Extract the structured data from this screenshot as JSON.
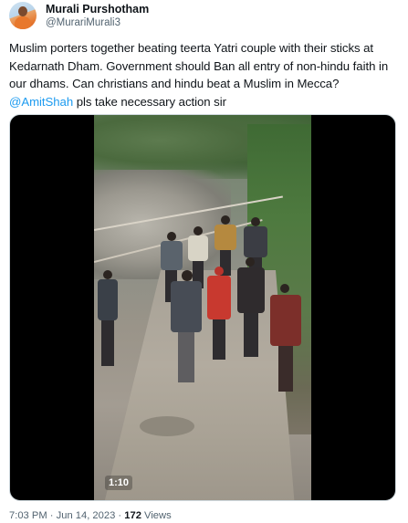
{
  "author": {
    "display_name": "Murali Purshotham",
    "handle": "@MurariMurali3",
    "avatar_icon": "profile-photo-avatar"
  },
  "tweet": {
    "lines": [
      "Muslim porters together beating teerta Yatri couple with their sticks at",
      "Kedarnath Dham. Government should Ban all entry of non-hindu faith in",
      "our dhams. Can christians and hindu beat a Muslim in Mecca?"
    ],
    "mention": "@AmitShah",
    "mention_rest": " pls take necessary action sir",
    "mention_color": "#1d9bf0"
  },
  "media": {
    "duration": "1:10"
  },
  "meta": {
    "time": "7:03 PM",
    "separator": " · ",
    "date": "Jun 14, 2023",
    "views_count": "172",
    "views_label": " Views"
  }
}
